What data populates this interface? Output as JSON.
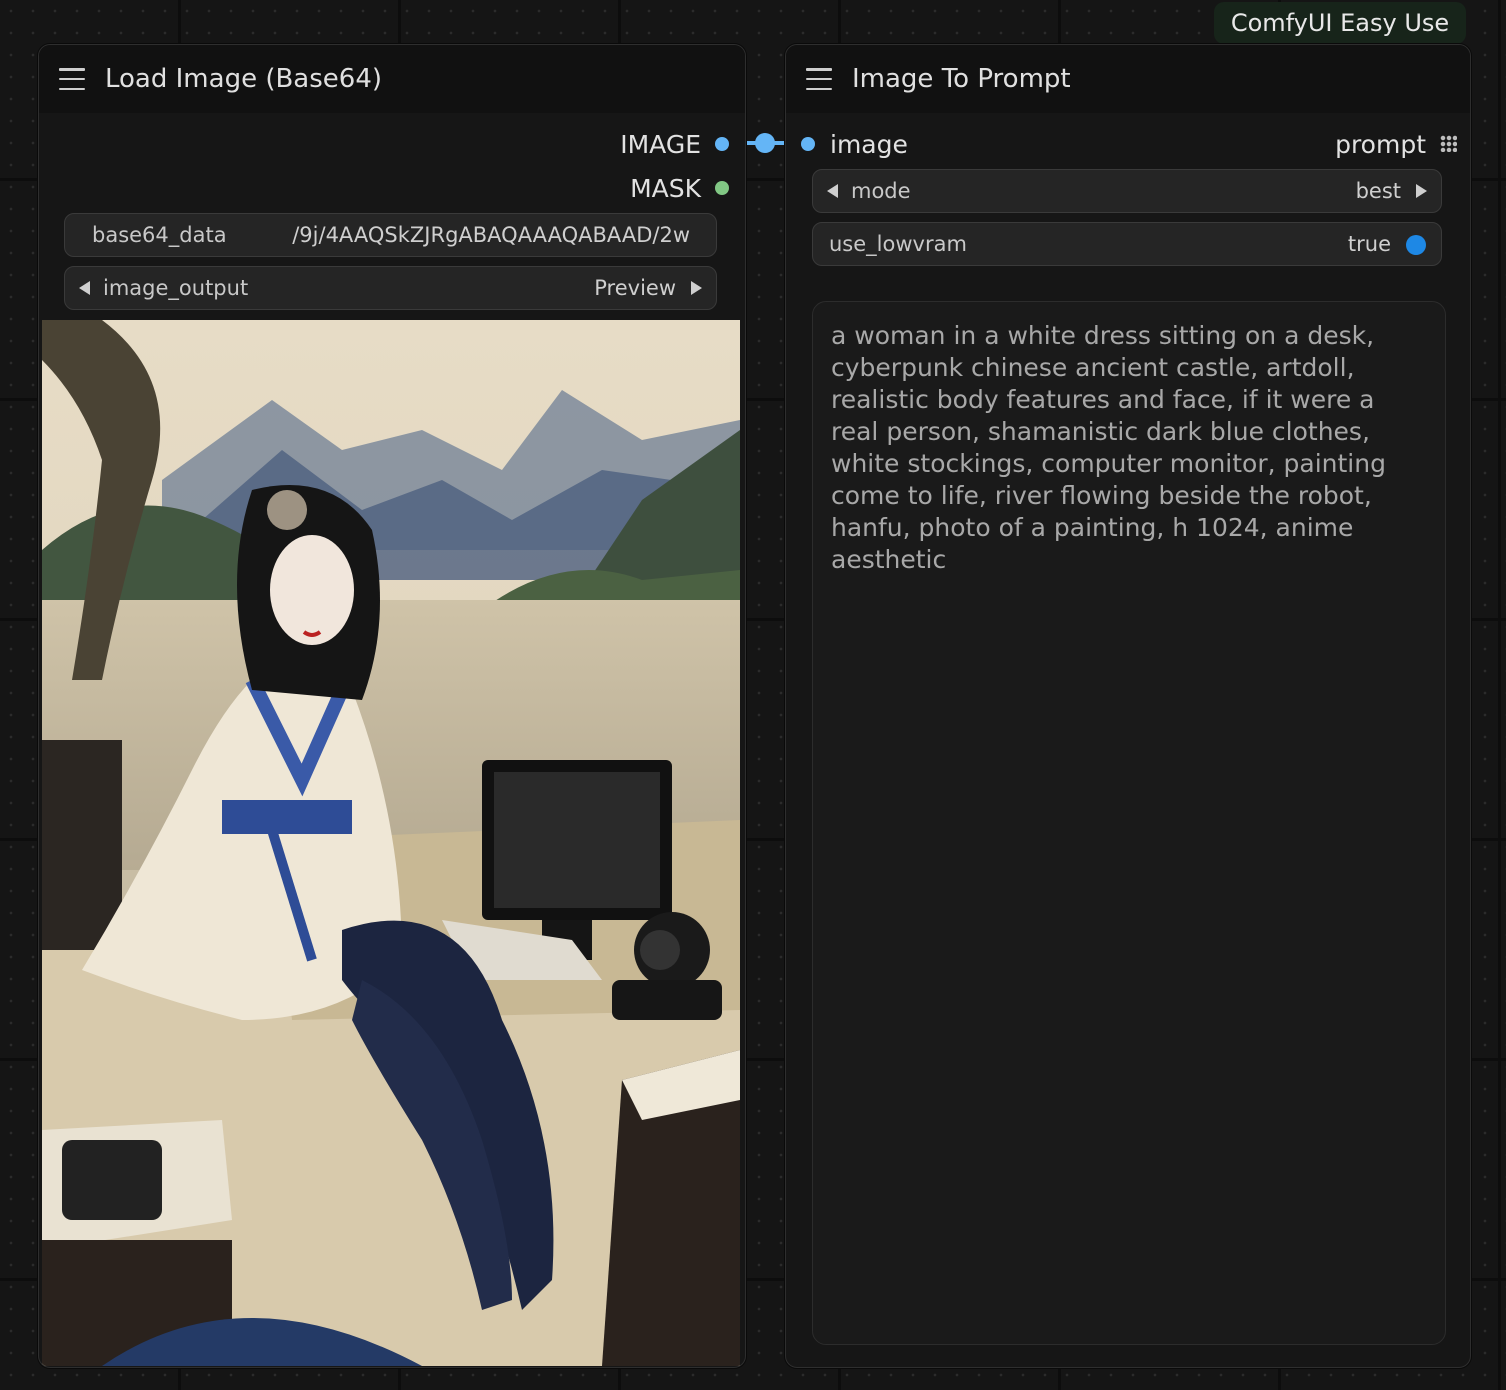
{
  "badge": {
    "label": "ComfyUI Easy Use"
  },
  "load_node": {
    "title": "Load Image (Base64)",
    "outputs": [
      {
        "label": "IMAGE",
        "color": "#64b5f6"
      },
      {
        "label": "MASK",
        "color": "#81c784"
      }
    ],
    "base64_field": {
      "label": "base64_data",
      "value": "/9j/4AAQSkZJRgABAQAAAQABAAD/2w"
    },
    "image_output": {
      "label": "image_output",
      "value": "Preview"
    }
  },
  "prompt_node": {
    "title": "Image To Prompt",
    "input_label": "image",
    "output_label": "prompt",
    "mode": {
      "label": "mode",
      "value": "best"
    },
    "use_lowvram": {
      "label": "use_lowvram",
      "value": "true",
      "color": "#1e88e5"
    },
    "prompt_text": "a woman in a white dress sitting on a desk, cyberpunk chinese ancient castle, artdoll, realistic body features and face, if it were a real person, shamanistic dark blue clothes, white stockings, computer monitor, painting come to life, river flowing beside the robot, hanfu, photo of a painting, h 1024, anime aesthetic"
  },
  "link": {
    "color": "#64b5f6"
  },
  "icons": [
    "menu-icon",
    "grid-icon",
    "arrow-left-icon",
    "arrow-right-icon",
    "toggle-dot-icon"
  ]
}
